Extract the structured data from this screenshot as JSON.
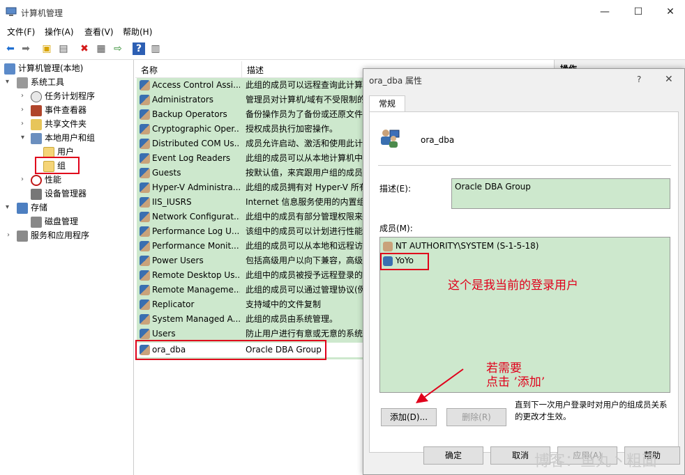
{
  "window": {
    "title": "计算机管理",
    "controls": [
      "—",
      "☐",
      "✕"
    ]
  },
  "menu": [
    "文件(F)",
    "操作(A)",
    "查看(V)",
    "帮助(H)"
  ],
  "tree": {
    "root": "计算机管理(本地)",
    "system_tools": "系统工具",
    "task_scheduler": "任务计划程序",
    "event_viewer": "事件查看器",
    "shared_folders": "共享文件夹",
    "local_users_groups": "本地用户和组",
    "users": "用户",
    "groups": "组",
    "performance": "性能",
    "device_manager": "设备管理器",
    "storage": "存储",
    "disk_management": "磁盘管理",
    "services_apps": "服务和应用程序"
  },
  "list": {
    "col_name": "名称",
    "col_desc": "描述",
    "rows": [
      {
        "name": "Access Control Assi...",
        "desc": "此组的成员可以远程查询此计算"
      },
      {
        "name": "Administrators",
        "desc": "管理员对计算机/域有不受限制的"
      },
      {
        "name": "Backup Operators",
        "desc": "备份操作员为了备份或还原文件"
      },
      {
        "name": "Cryptographic Oper...",
        "desc": "授权成员执行加密操作。"
      },
      {
        "name": "Distributed COM Us...",
        "desc": "成员允许启动、激活和使用此计"
      },
      {
        "name": "Event Log Readers",
        "desc": "此组的成员可以从本地计算机中"
      },
      {
        "name": "Guests",
        "desc": "按默认值，来宾跟用户组的成员"
      },
      {
        "name": "Hyper-V Administra...",
        "desc": "此组的成员拥有对 Hyper-V 所有"
      },
      {
        "name": "IIS_IUSRS",
        "desc": "Internet 信息服务使用的内置组"
      },
      {
        "name": "Network Configurat...",
        "desc": "此组中的成员有部分管理权限来"
      },
      {
        "name": "Performance Log U...",
        "desc": "该组中的成员可以计划进行性能"
      },
      {
        "name": "Performance Monit...",
        "desc": "此组的成员可以从本地和远程访"
      },
      {
        "name": "Power Users",
        "desc": "包括高级用户以向下兼容，高级"
      },
      {
        "name": "Remote Desktop Us...",
        "desc": "此组中的成员被授予远程登录的"
      },
      {
        "name": "Remote Manageme...",
        "desc": "此组的成员可以通过管理协议(例"
      },
      {
        "name": "Replicator",
        "desc": "支持域中的文件复制"
      },
      {
        "name": "System Managed A...",
        "desc": "此组的成员由系统管理。"
      },
      {
        "name": "Users",
        "desc": "防止用户进行有意或无意的系统"
      },
      {
        "name": "ora_dba",
        "desc": "Oracle DBA Group"
      }
    ]
  },
  "right_pane": {
    "header": "操作"
  },
  "dialog": {
    "title": "ora_dba 属性",
    "help": "?",
    "close": "✕",
    "tab": "常规",
    "group_name": "ora_dba",
    "desc_label": "描述(E):",
    "desc_value": "Oracle DBA Group",
    "members_label": "成员(M):",
    "members": [
      "NT AUTHORITY\\SYSTEM (S-1-5-18)",
      "YoYo"
    ],
    "note": "直到下一次用户登录时对用户的组成员关系的更改才生效。",
    "add_button": "添加(D)...",
    "remove_button": "删除(R)",
    "ok_button": "确定",
    "cancel_button": "取消",
    "apply_button": "应用(A)",
    "help_button": "帮助"
  },
  "annotations": {
    "current_user": "这个是我当前的登录用户",
    "hint_line1": "若需要",
    "hint_line2": "点击 ’添加’",
    "color": "#e0001b"
  },
  "watermark": "博客：鱼丸丶粗面"
}
